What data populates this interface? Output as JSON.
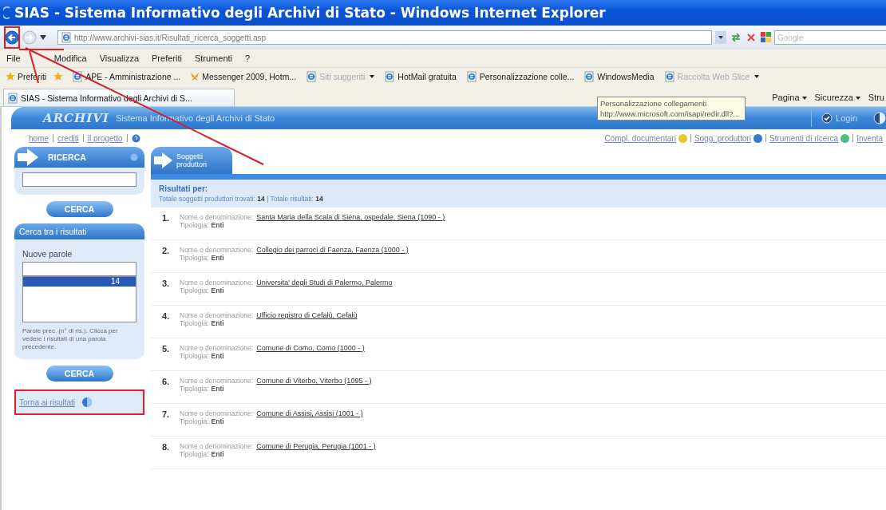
{
  "window": {
    "title": "SIAS - Sistema Informativo degli Archivi di Stato - Windows Internet Explorer"
  },
  "address_bar": {
    "url": "http://www.archivi-sias.it/Risultati_ricerca_soggetti.asp",
    "search_placeholder": "Google"
  },
  "menu": [
    "File",
    "Modifica",
    "Visualizza",
    "Preferiti",
    "Strumenti",
    "?"
  ],
  "favorites_bar": {
    "label": "Preferiti",
    "items": [
      {
        "label": "APE - Amministrazione ...",
        "dropdown": false
      },
      {
        "label": "Messenger 2009, Hotm...",
        "dropdown": false
      },
      {
        "label": "Siti suggeriti",
        "dropdown": true
      },
      {
        "label": "HotMail gratuita",
        "dropdown": false
      },
      {
        "label": "Personalizzazione colle...",
        "dropdown": false
      },
      {
        "label": "WindowsMedia",
        "dropdown": false
      },
      {
        "label": "Raccolta Web Slice",
        "dropdown": true
      }
    ]
  },
  "tabs": [
    {
      "label": "SIAS - Sistema Informativo degli Archivi di S...",
      "selected": true
    }
  ],
  "command_bar": [
    {
      "label": "Pagina",
      "dropdown": true
    },
    {
      "label": "Sicurezza",
      "dropdown": true
    },
    {
      "label": "Stru",
      "dropdown": false
    }
  ],
  "tooltip": {
    "title": "Personalizzazione collegamenti",
    "url": "http://www.microsoft.com/isapi/redir.dll?..."
  },
  "site": {
    "logo": "ARCHIVI",
    "subtitle": "Sistema Informativo degli Archivi di Stato",
    "login": "Login"
  },
  "top_links": [
    "home",
    "crediti",
    "il progetto"
  ],
  "sections": [
    {
      "label": "Compl. documentari",
      "color": "#e8c830"
    },
    {
      "label": "Sogg. produttori",
      "color": "#3a78d0"
    },
    {
      "label": "Strumenti di ricerca",
      "color": "#4cc080"
    },
    {
      "label": "Inventa"
    }
  ],
  "sidebar": {
    "search": {
      "title": "RICERCA",
      "button": "CERCA"
    },
    "refine": {
      "title": "Cerca tra i risultati",
      "label": "Nuove parole",
      "previous": [
        {
          "label": "14",
          "selected": true
        }
      ],
      "hint": "Parole prec. (n° di ris.). Clicca per vedere i risultati di una parola precedente.",
      "button": "CERCA"
    },
    "back_link": "Torna ai risultati"
  },
  "results": {
    "tab": {
      "label": "Soggetti produttori",
      "selected": true
    },
    "heading": "Risultati per:",
    "summary": "Totale soggetti produttori trovati: **14** | Totale risultati: **14**",
    "items": [
      {
        "number": "1.",
        "label": "Nome o denominazione:",
        "name": "Santa Maria della Scala di Siena, ospedale, Siena (1090 - )",
        "type_label": "Tipologia:",
        "type": "Enti"
      },
      {
        "number": "2.",
        "label": "Nome o denominazione:",
        "name": "Collegio dei parroci di Faenza, Faenza (1000 - )",
        "type_label": "Tipologia:",
        "type": "Enti"
      },
      {
        "number": "3.",
        "label": "Nome o denominazione:",
        "name": "Universita' degli Studi di Palermo, Palermo",
        "type_label": "Tipologia:",
        "type": "Enti"
      },
      {
        "number": "4.",
        "label": "Nome o denominazione:",
        "name": "Ufficio registro di Cefalù, Cefalù",
        "type_label": "Tipologia:",
        "type": "Enti"
      },
      {
        "number": "5.",
        "label": "Nome o denominazione:",
        "name": "Comune di Como, Como (1000 - )",
        "type_label": "Tipologia:",
        "type": "Enti"
      },
      {
        "number": "6.",
        "label": "Nome o denominazione:",
        "name": "Comune di Viterbo, Viterbo (1095 - )",
        "type_label": "Tipologia:",
        "type": "Enti"
      },
      {
        "number": "7.",
        "label": "Nome o denominazione:",
        "name": "Comune di Assisi, Assisi (1001 - )",
        "type_label": "Tipologia:",
        "type": "Enti"
      },
      {
        "number": "8.",
        "label": "Nome o denominazione:",
        "name": "Comune di Perugia, Perugia (1001 - )",
        "type_label": "Tipologia:",
        "type": "Enti"
      }
    ]
  }
}
